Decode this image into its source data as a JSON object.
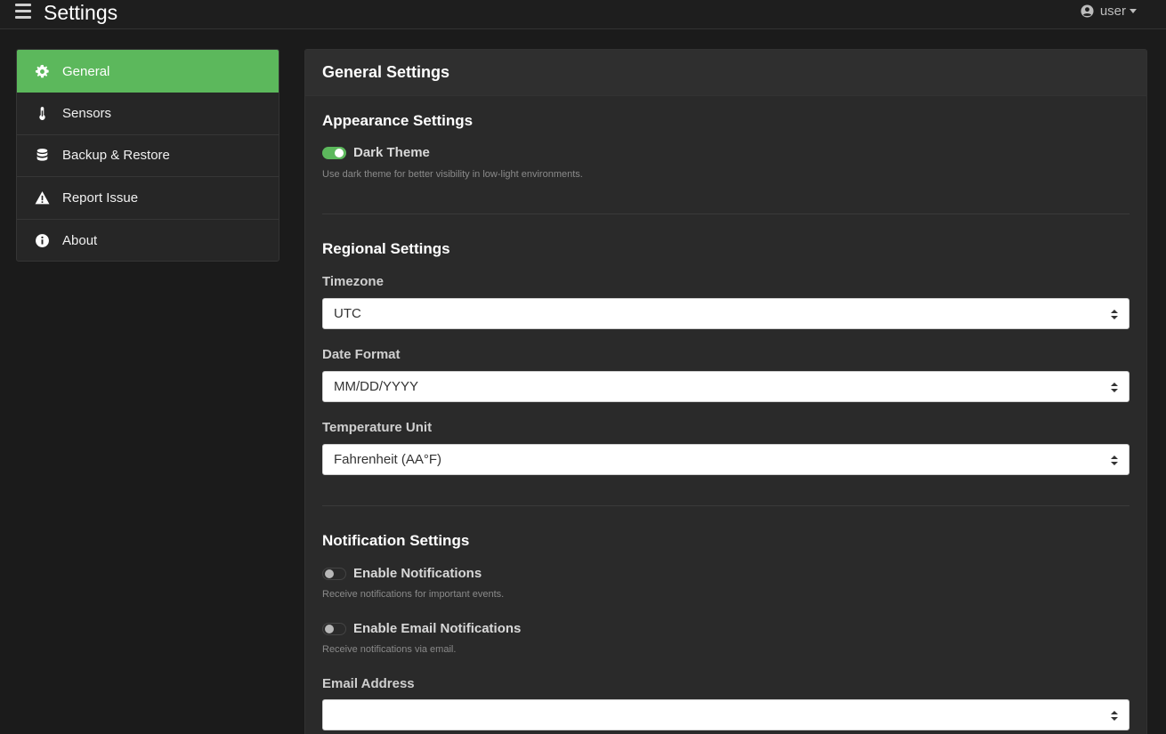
{
  "header": {
    "title": "Settings",
    "user_label": "user"
  },
  "sidebar": {
    "items": [
      {
        "label": "General",
        "icon": "gear-icon",
        "active": true
      },
      {
        "label": "Sensors",
        "icon": "thermometer-icon",
        "active": false
      },
      {
        "label": "Backup & Restore",
        "icon": "database-icon",
        "active": false
      },
      {
        "label": "Report Issue",
        "icon": "warning-icon",
        "active": false
      },
      {
        "label": "About",
        "icon": "info-icon",
        "active": false
      }
    ]
  },
  "main": {
    "title": "General Settings",
    "appearance": {
      "title": "Appearance Settings",
      "dark_theme": {
        "label": "Dark Theme",
        "enabled": true,
        "help": "Use dark theme for better visibility in low-light environments."
      }
    },
    "regional": {
      "title": "Regional Settings",
      "timezone": {
        "label": "Timezone",
        "value": "UTC"
      },
      "date_format": {
        "label": "Date Format",
        "value": "MM/DD/YYYY"
      },
      "temperature_unit": {
        "label": "Temperature Unit",
        "value": "Fahrenheit (AA°F)"
      }
    },
    "notifications": {
      "title": "Notification Settings",
      "enable_notifications": {
        "label": "Enable Notifications",
        "enabled": false,
        "help": "Receive notifications for important events."
      },
      "enable_email": {
        "label": "Enable Email Notifications",
        "enabled": false,
        "help": "Receive notifications via email."
      },
      "email_address": {
        "label": "Email Address",
        "value": ""
      }
    }
  },
  "colors": {
    "accent": "#5cb85c",
    "background": "#1b1b1b",
    "card": "#2a2a2a"
  }
}
